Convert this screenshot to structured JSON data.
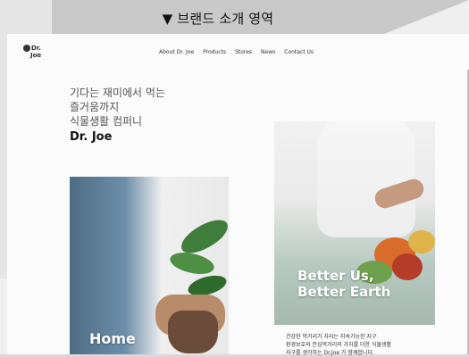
{
  "top_banner": {
    "title": "▼ 브랜드 소개 영역"
  },
  "nav": {
    "logo": {
      "line1": "Dr.",
      "line2": "Joe"
    },
    "items": [
      "About Dr. Joe",
      "Products",
      "Stores",
      "News",
      "Contact Us"
    ]
  },
  "hero": {
    "lines": [
      "기다는 재미에서 먹는",
      "즐거움까지",
      "식물생활 컴퍼니"
    ],
    "brand": "Dr. Joe"
  },
  "left_image": {
    "label": "Home"
  },
  "right_image": {
    "caption_lines": [
      "Better Us,",
      "Better Earth"
    ]
  },
  "description": {
    "lines": [
      "건강한 먹거리가 자라는 지속가능한 지구",
      "환경보호와 안심먹거리의 가치를 더한 식물생활",
      "지구를 생각하는 Dr.Joe 가 함께합니다."
    ]
  }
}
